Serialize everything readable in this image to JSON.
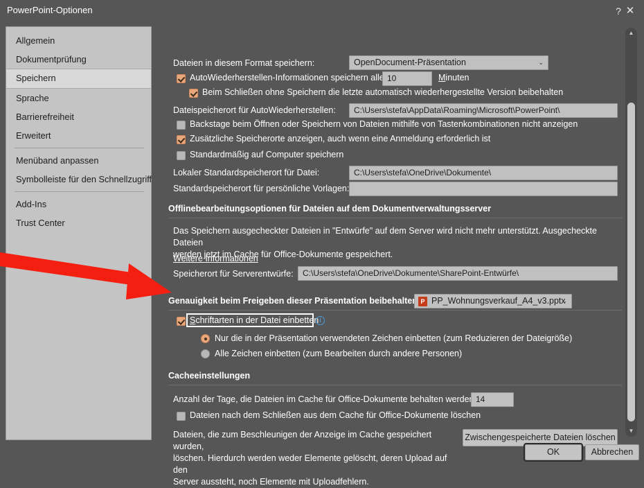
{
  "window": {
    "title": "PowerPoint-Optionen",
    "help_label": "?",
    "close_label": "✕"
  },
  "sidebar": {
    "items": [
      {
        "label": "Allgemein",
        "selected": false
      },
      {
        "label": "Dokumentprüfung",
        "selected": false
      },
      {
        "label": "Speichern",
        "selected": true
      },
      {
        "label": "Sprache",
        "selected": false
      },
      {
        "label": "Barrierefreiheit",
        "selected": false
      },
      {
        "label": "Erweitert",
        "selected": false
      },
      {
        "label": "Menüband anpassen",
        "selected": false
      },
      {
        "label": "Symbolleiste für den Schnellzugriff",
        "selected": false
      },
      {
        "label": "Add-Ins",
        "selected": false
      },
      {
        "label": "Trust Center",
        "selected": false
      }
    ]
  },
  "save_section": {
    "format_label": "Dateien in diesem Format speichern:",
    "format_value": "OpenDocument-Präsentation",
    "autorecover_label": "AutoWiederherstellen-Informationen speichern alle",
    "autorecover_checked": true,
    "autorecover_minutes": "10",
    "autorecover_minutes_label": "Minuten",
    "keep_last_label": "Beim Schließen ohne Speichern die letzte automatisch wiederhergestellte Version beibehalten",
    "keep_last_checked": true,
    "autorecover_path_label": "Dateispeicherort für AutoWiederherstellen:",
    "autorecover_path_value": "C:\\Users\\stefa\\AppData\\Roaming\\Microsoft\\PowerPoint\\",
    "backstage_label": "Backstage beim Öffnen oder Speichern von Dateien mithilfe von Tastenkombinationen nicht anzeigen",
    "backstage_checked": false,
    "additional_locations_label": "Zusätzliche Speicherorte anzeigen, auch wenn eine Anmeldung erforderlich ist",
    "additional_locations_checked": true,
    "save_to_computer_label": "Standardmäßig auf Computer speichern",
    "save_to_computer_checked": false,
    "local_default_label": "Lokaler Standardspeicherort für Datei:",
    "local_default_value": "C:\\Users\\stefa\\OneDrive\\Dokumente\\",
    "personal_templates_label": "Standardspeicherort für persönliche Vorlagen:",
    "personal_templates_value": ""
  },
  "offline_section": {
    "heading": "Offlinebearbeitungsoptionen für Dateien auf dem Dokumentverwaltungsserver",
    "description_line1": "Das Speichern ausgecheckter Dateien in \"Entwürfe\" auf dem Server wird nicht mehr unterstützt. Ausgecheckte Dateien",
    "description_line2": "werden jetzt im Cache für Office-Dokumente gespeichert.",
    "more_info_link": "Weitere Informationen",
    "server_drafts_label": "Speicherort für Serverentwürfe:",
    "server_drafts_value": "C:\\Users\\stefa\\OneDrive\\Dokumente\\SharePoint-Entwürfe\\"
  },
  "fidelity_section": {
    "heading": "Genauigkeit beim Freigeben dieser Präsentation beibehalten",
    "file_value": "PP_Wohnungsverkauf_A4_v3.pptx",
    "file_icon": "powerpoint-file-icon",
    "embed_fonts_label": "Schriftarten in der Datei einbetten",
    "embed_fonts_checked": true,
    "embed_fonts_focused": true,
    "info_icon": "info-icon",
    "radio_used_chars_label": "Nur die in der Präsentation verwendeten Zeichen einbetten (zum Reduzieren der Dateigröße)",
    "radio_all_chars_label": "Alle Zeichen einbetten (zum Bearbeiten durch andere Personen)",
    "radio_selected": "used_chars"
  },
  "cache_section": {
    "heading": "Cacheeinstellungen",
    "days_label": "Anzahl der Tage, die Dateien im Cache für Office-Dokumente behalten werden:",
    "days_value": "14",
    "delete_on_close_label": "Dateien nach dem Schließen aus dem Cache für Office-Dokumente löschen",
    "delete_on_close_checked": false,
    "cache_desc_line1": "Dateien, die zum Beschleunigen der Anzeige im Cache gespeichert wurden,",
    "cache_desc_line2": "löschen. Hierdurch werden weder Elemente gelöscht, deren Upload auf den",
    "cache_desc_line3": "Server aussteht, noch Elemente mit Uploadfehlern.",
    "delete_cached_button": "Zwischengespeicherte Dateien löschen"
  },
  "footer": {
    "ok_label": "OK",
    "cancel_label": "Abbrechen"
  },
  "scrollbar": {
    "up_arrow": "▲",
    "down_arrow": "▼"
  },
  "annotation": {
    "arrow_color": "#f41f10",
    "arrow_name": "red-pointer-arrow"
  },
  "colors": {
    "dialog_bg": "#565656",
    "sidebar_bg": "#c4c4c4",
    "accent_checkbox": "#e8a87c",
    "field_bg": "#c0c0c0",
    "info_blue": "#4a9fd8",
    "powerpoint_red": "#c43e1c"
  }
}
